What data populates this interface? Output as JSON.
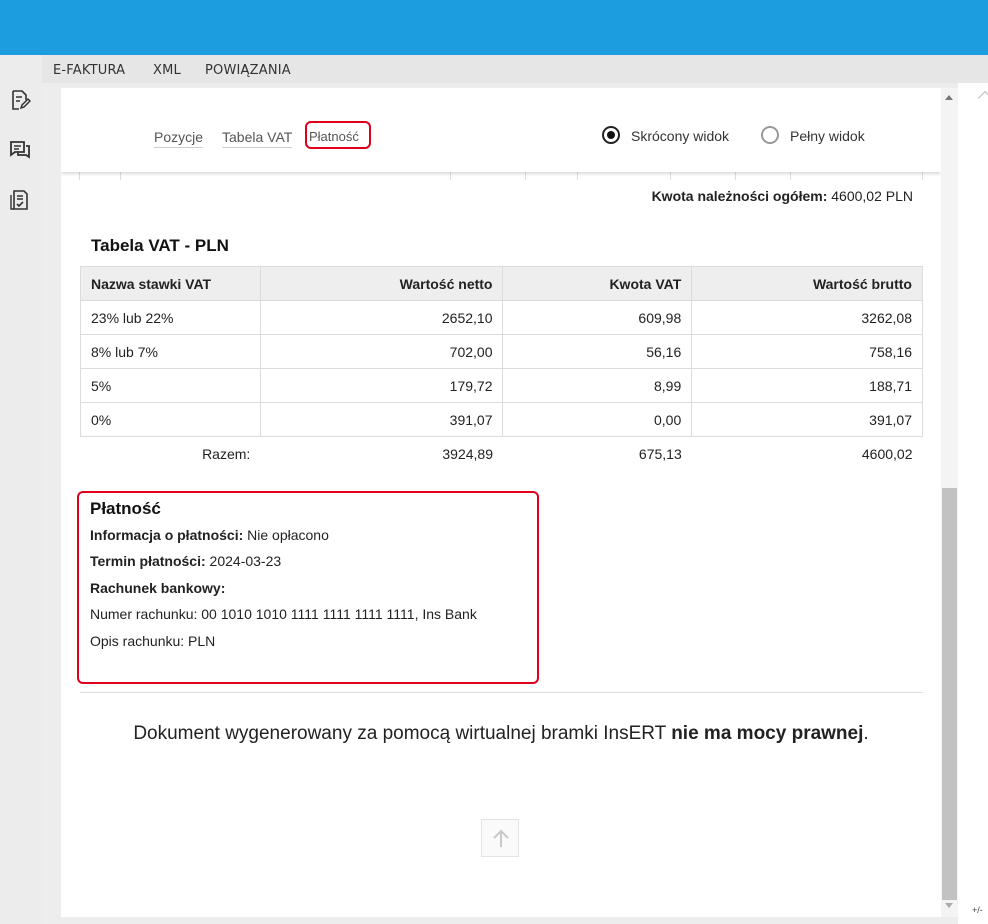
{
  "menu": {
    "items": [
      "E-FAKTURA",
      "XML",
      "POWIĄZANIA"
    ]
  },
  "sidebar": {
    "icons": [
      "edit-document-icon",
      "comments-icon",
      "document-check-icon"
    ]
  },
  "nav": {
    "tabs": [
      "Pozycje",
      "Tabela VAT",
      "Płatność"
    ],
    "active_tab": "Płatność",
    "view_options": [
      "Skrócony widok",
      "Pełny widok"
    ],
    "selected_view": "Skrócony widok"
  },
  "summary": {
    "label": "Kwota należności ogółem:",
    "value": "4600,02 PLN"
  },
  "vat_table": {
    "title": "Tabela VAT - PLN",
    "headers": [
      "Nazwa stawki VAT",
      "Wartość netto",
      "Kwota VAT",
      "Wartość brutto"
    ],
    "rows": [
      [
        "23% lub 22%",
        "2652,10",
        "609,98",
        "3262,08"
      ],
      [
        "8% lub 7%",
        "702,00",
        "56,16",
        "758,16"
      ],
      [
        "5%",
        "179,72",
        "8,99",
        "188,71"
      ],
      [
        "0%",
        "391,07",
        "0,00",
        "391,07"
      ]
    ],
    "total": [
      "Razem:",
      "3924,89",
      "675,13",
      "4600,02"
    ]
  },
  "payment": {
    "title": "Płatność",
    "info_label": "Informacja o płatności:",
    "info_value": "Nie opłacono",
    "due_label": "Termin płatności:",
    "due_value": "2024-03-23",
    "bank_label": "Rachunek bankowy:",
    "account_number": "Numer rachunku: 00 1010 1010 1111 1111 1111 1111, Ins Bank",
    "account_desc": "Opis rachunku: PLN"
  },
  "footer": {
    "text": "Dokument wygenerowany za pomocą wirtualnej bramki InsERT ",
    "bold": "nie ma mocy prawnej",
    "end": "."
  },
  "misc": {
    "corner": "+/-"
  },
  "colors": {
    "titlebar": "#1b9de0",
    "highlight": "#e0001b"
  }
}
